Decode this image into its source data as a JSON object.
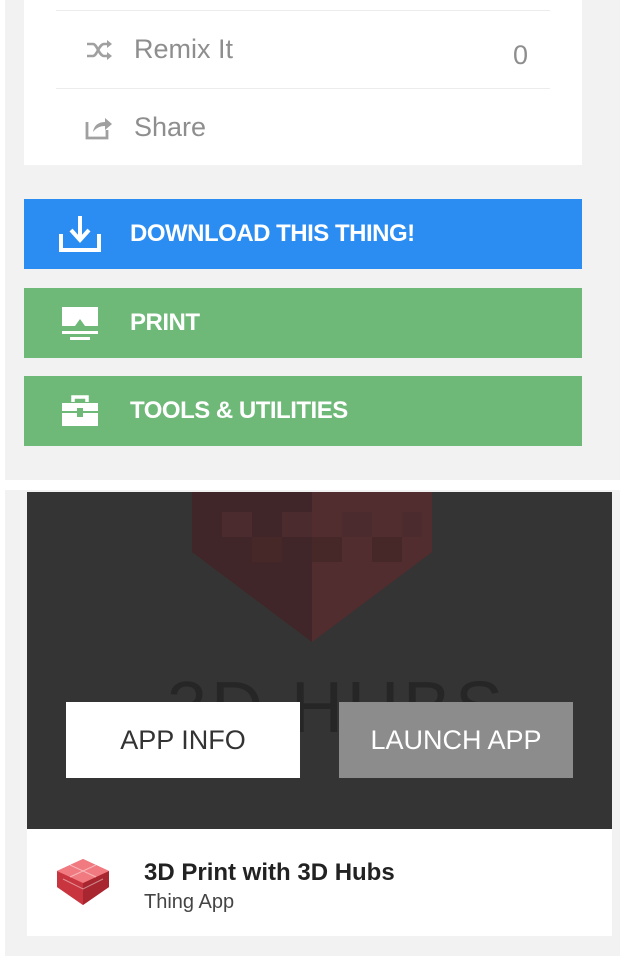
{
  "actions": {
    "remix": {
      "label": "Remix It",
      "count": "0",
      "icon": "shuffle-icon"
    },
    "share": {
      "label": "Share",
      "icon": "share-icon"
    }
  },
  "buttons": {
    "download": {
      "label": "DOWNLOAD THIS THING!",
      "icon": "download-icon",
      "color": "#2b8cf2"
    },
    "print": {
      "label": "PRINT",
      "icon": "printer-icon",
      "color": "#6eb878"
    },
    "tools": {
      "label": "TOOLS & UTILITIES",
      "icon": "toolbox-icon",
      "color": "#6eb878"
    }
  },
  "app": {
    "hero_text": "3D HUBS",
    "info_button": "APP INFO",
    "launch_button": "LAUNCH APP",
    "name": "3D Print with 3D Hubs",
    "type": "Thing App",
    "brand_color": "#c8353f"
  }
}
